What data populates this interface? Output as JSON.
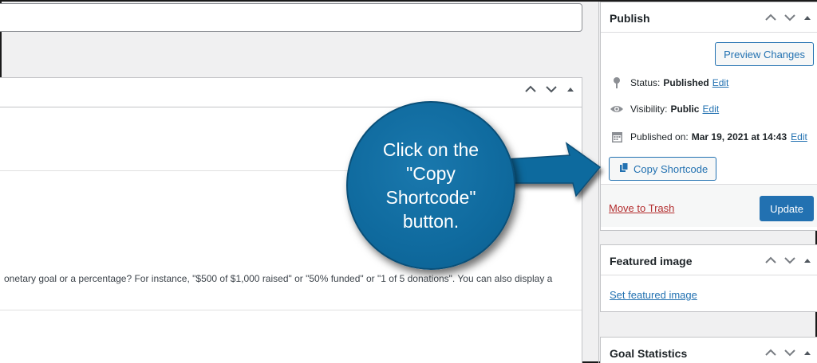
{
  "editor": {
    "body_text": "onetary goal or a percentage? For instance, \"$500 of $1,000 raised\" or \"50% funded\" or \"1 of 5 donations\". You can also display a"
  },
  "publish": {
    "title": "Publish",
    "preview_label": "Preview Changes",
    "status_label": "Status:",
    "status_value": "Published",
    "visibility_label": "Visibility:",
    "visibility_value": "Public",
    "published_label": "Published on:",
    "published_value": "Mar 19, 2021 at 14:43",
    "edit_label": "Edit",
    "copy_shortcode_label": "Copy Shortcode",
    "trash_label": "Move to Trash",
    "update_label": "Update"
  },
  "featured_image": {
    "title": "Featured image",
    "set_label": "Set featured image"
  },
  "goal_statistics": {
    "title": "Goal Statistics"
  },
  "callout": {
    "text": "Click on the\n\"Copy\nShortcode\"\nbutton."
  },
  "colors": {
    "accent": "#2271b1",
    "callout": "#0f6a9e",
    "danger": "#b32d2e"
  },
  "icons": [
    "chevron-up-icon",
    "chevron-down-icon",
    "triangle-up-icon",
    "pin-icon",
    "eye-icon",
    "calendar-icon",
    "copy-icon"
  ]
}
